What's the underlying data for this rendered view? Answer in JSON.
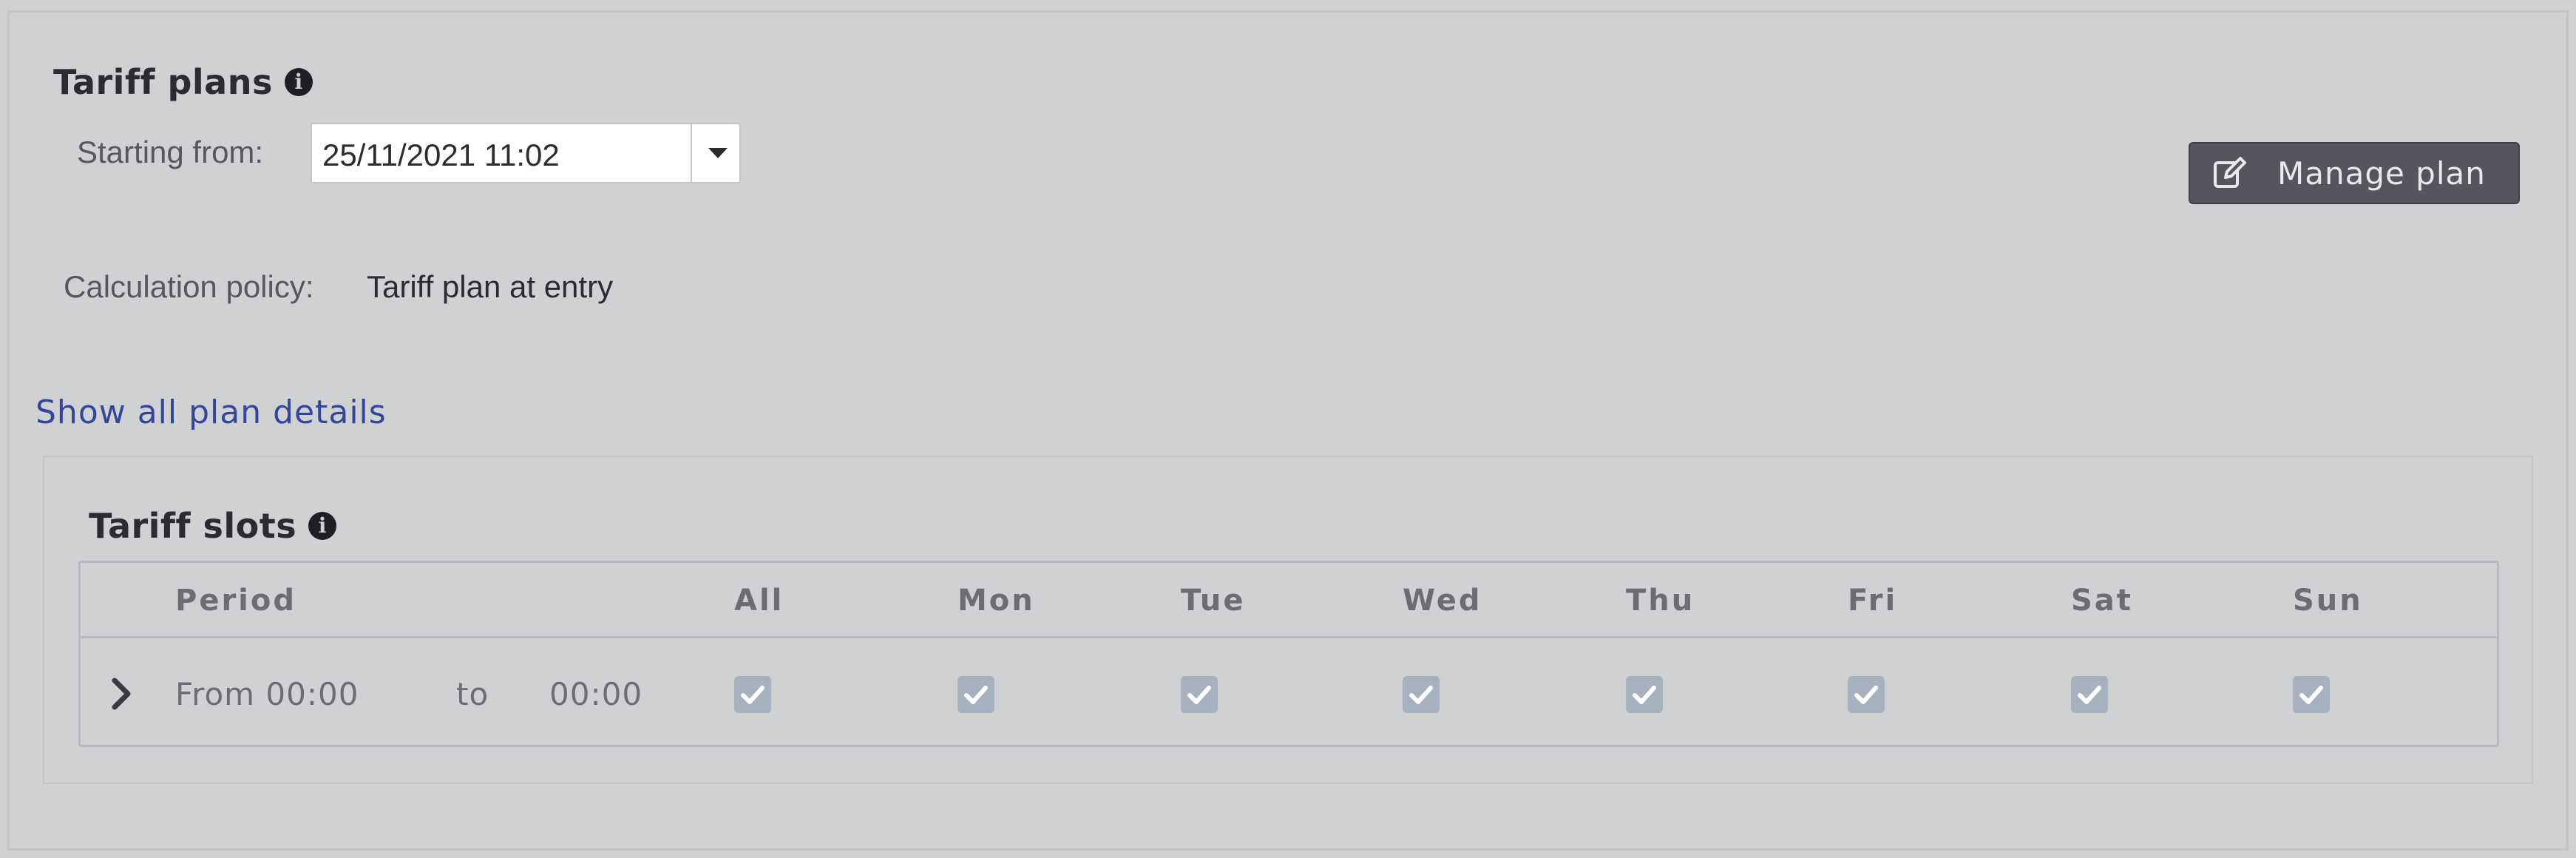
{
  "tariff_plans": {
    "title": "Tariff plans",
    "info_icon": "info-icon",
    "starting_from_label": "Starting from:",
    "starting_from_value": "25/11/2021 11:02",
    "dropdown_icon": "caret-down-icon",
    "manage_button_label": "Manage plan",
    "manage_button_icon": "edit-icon",
    "calc_policy_label": "Calculation policy:",
    "calc_policy_value": "Tariff plan at entry",
    "show_all_link": "Show all plan details"
  },
  "tariff_slots": {
    "title": "Tariff slots",
    "info_icon": "info-icon",
    "columns": [
      "Period",
      "All",
      "Mon",
      "Tue",
      "Wed",
      "Thu",
      "Fri",
      "Sat",
      "Sun"
    ],
    "rows": [
      {
        "from_label": "From 00:00",
        "to_label": "to",
        "to_value": "00:00",
        "checked": [
          true,
          true,
          true,
          true,
          true,
          true,
          true,
          true
        ]
      }
    ]
  },
  "colors": {
    "background": "#d0d1d3",
    "button_bg": "#55565d",
    "link": "#34469a",
    "checkbox_disabled": "#a7b1bd"
  }
}
